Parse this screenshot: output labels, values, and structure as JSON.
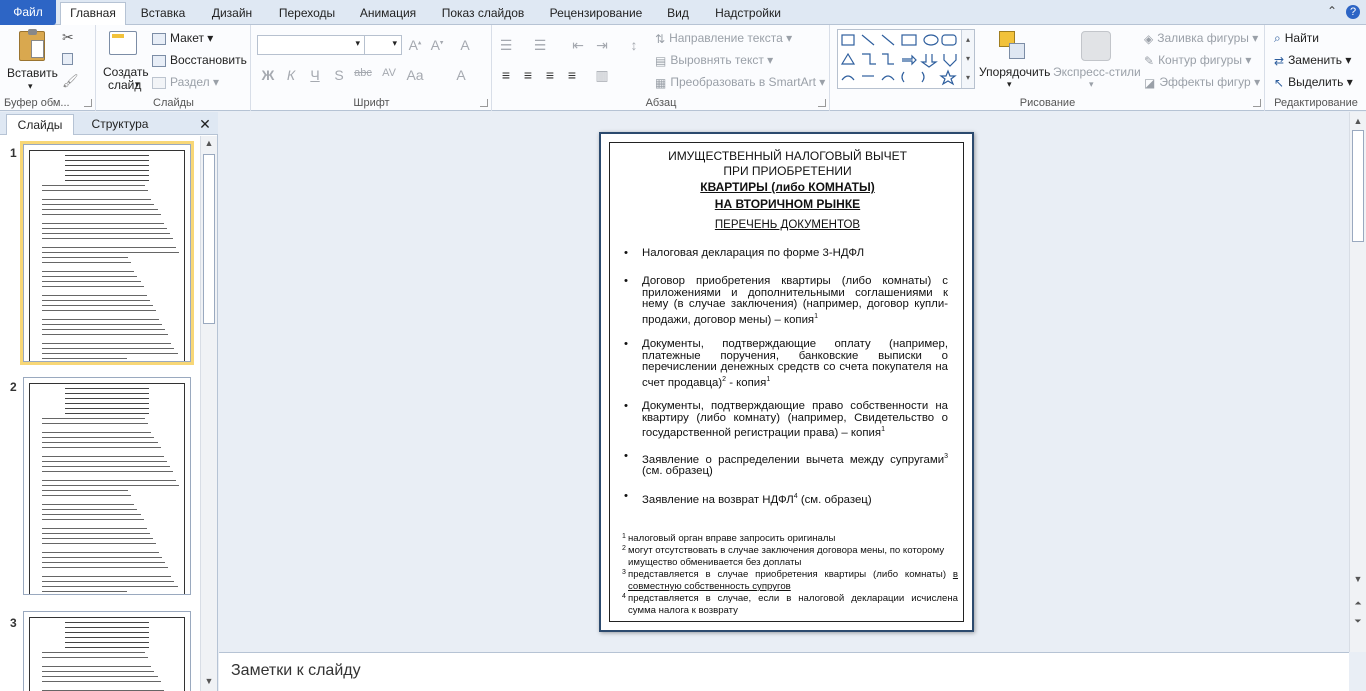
{
  "tabs": {
    "file": "Файл",
    "home": "Главная",
    "insert": "Вставка",
    "design": "Дизайн",
    "transitions": "Переходы",
    "animation": "Анимация",
    "slideshow": "Показ слайдов",
    "review": "Рецензирование",
    "view": "Вид",
    "addins": "Надстройки"
  },
  "ribbon": {
    "clipboard": {
      "label": "Буфер обм...",
      "paste": "Вставить"
    },
    "slides": {
      "label": "Слайды",
      "new_slide_1": "Создать",
      "new_slide_2": "слайд",
      "layout": "Макет",
      "reset": "Восстановить",
      "section": "Раздел"
    },
    "font": {
      "label": "Шрифт"
    },
    "paragraph": {
      "label": "Абзац",
      "text_direction": "Направление текста",
      "align_text": "Выровнять текст",
      "smartart": "Преобразовать в SmartArt"
    },
    "drawing": {
      "label": "Рисование",
      "arrange": "Упорядочить",
      "quick_styles": "Экспресс-стили",
      "fill": "Заливка фигуры",
      "outline": "Контур фигуры",
      "effects": "Эффекты фигур"
    },
    "editing": {
      "label": "Редактирование",
      "find": "Найти",
      "replace": "Заменить",
      "select": "Выделить"
    }
  },
  "pane": {
    "slides_tab": "Слайды",
    "outline_tab": "Структура"
  },
  "thumbnails": [
    {
      "number": "1"
    },
    {
      "number": "2"
    },
    {
      "number": "3"
    }
  ],
  "slide": {
    "title_1": "ИМУЩЕСТВЕННЫЙ НАЛОГОВЫЙ ВЫЧЕТ",
    "title_2": "ПРИ ПРИОБРЕТЕНИИ",
    "title_3": "КВАРТИРЫ (либо КОМНАТЫ)",
    "title_4": "НА ВТОРИЧНОМ РЫНКЕ",
    "subtitle": "ПЕРЕЧЕНЬ ДОКУМЕНТОВ",
    "bullets": [
      {
        "text": "Налоговая декларация по форме 3-НДФЛ",
        "sup": ""
      },
      {
        "text": "Договор приобретения квартиры (либо комнаты) с приложениями и дополнительными соглашениями к нему (в случае заключения) (например, договор купли-продажи, договор мены) – копия",
        "sup": "1"
      },
      {
        "text": "Документы, подтверждающие оплату (например, платежные поручения, банковские выписки о перечислении денежных средств со счета покупателя на счет продавца)",
        "sup": "2",
        "tail": " - копия",
        "sup2": "1"
      },
      {
        "text": "Документы, подтверждающие право собственности на квартиру (либо комнату) (например, Свидетельство о государственной регистрации права) – копия",
        "sup": "1"
      },
      {
        "text": "Заявление о распределении вычета между супругами",
        "sup": "3",
        "tail": " (см. образец)"
      },
      {
        "text": "Заявление на возврат НДФЛ",
        "sup": "4",
        "tail": " (см. образец)"
      }
    ],
    "footnotes": [
      {
        "n": "1",
        "text": "налоговый орган вправе запросить оригиналы"
      },
      {
        "n": "2",
        "text": "могут отсутствовать в случае заключения договора мены, по которому имущество обменивается без доплаты"
      },
      {
        "n": "3",
        "text": "представляется в случае приобретения квартиры (либо комнаты)",
        "underline": "в совместную собственность супругов"
      },
      {
        "n": "4",
        "text": "представляется в случае, если в налоговой декларации исчислена сумма налога к возврату"
      }
    ]
  },
  "notes": {
    "placeholder": "Заметки к слайду"
  },
  "colors": {
    "file_tab": "#2d65c5",
    "selected_thumb": "#f8d777",
    "slide_border": "#2c4a6e"
  }
}
